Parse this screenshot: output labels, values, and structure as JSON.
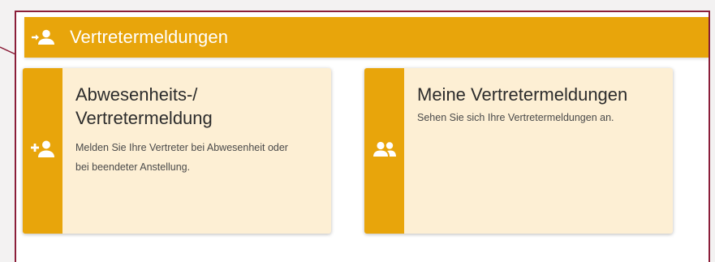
{
  "header": {
    "title": "Vertretermeldungen",
    "icon": "person-transfer-icon",
    "background_color": "#e8a50b"
  },
  "cards": [
    {
      "title_lines": [
        "Abwesenheits-/",
        "Vertretermeldung"
      ],
      "description_lines": [
        "Melden Sie Ihre Vertreter bei Abwesenheit oder",
        "bei beendeter Anstellung."
      ],
      "icon": "person-add-icon"
    },
    {
      "title_lines": [
        "Meine Vertretermeldungen"
      ],
      "description_lines": [
        "Sehen Sie sich Ihre Vertretermeldungen an."
      ],
      "icon": "people-group-icon"
    }
  ],
  "colors": {
    "accent": "#e8a50b",
    "card_background": "#fdefd4",
    "highlight_frame": "#8b1f3a"
  }
}
